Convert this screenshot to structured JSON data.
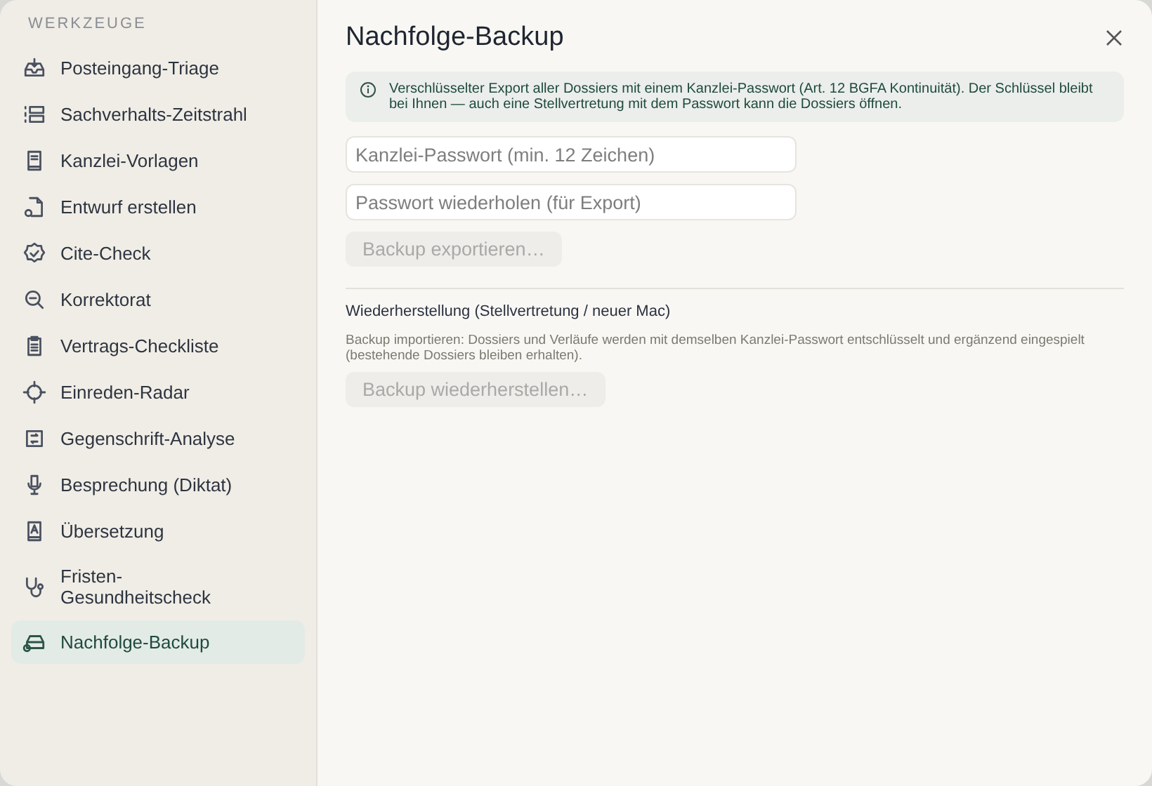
{
  "sidebar": {
    "heading": "WERKZEUGE",
    "items": [
      {
        "label": "Posteingang-Triage",
        "selected": false
      },
      {
        "label": "Sachverhalts-Zeitstrahl",
        "selected": false
      },
      {
        "label": "Kanzlei-Vorlagen",
        "selected": false
      },
      {
        "label": "Entwurf erstellen",
        "selected": false
      },
      {
        "label": "Cite-Check",
        "selected": false
      },
      {
        "label": "Korrektorat",
        "selected": false
      },
      {
        "label": "Vertrags-Checkliste",
        "selected": false
      },
      {
        "label": "Einreden-Radar",
        "selected": false
      },
      {
        "label": "Gegenschrift-Analyse",
        "selected": false
      },
      {
        "label": "Besprechung (Diktat)",
        "selected": false
      },
      {
        "label": "Übersetzung",
        "selected": false
      },
      {
        "label": "Fristen-\nGesundheitscheck",
        "selected": false
      },
      {
        "label": "Nachfolge-Backup",
        "selected": true
      }
    ]
  },
  "panel": {
    "title": "Nachfolge-Backup",
    "notice": "Verschlüsselter Export aller Dossiers mit einem Kanzlei-Passwort (Art. 12 BGFA Kontinuität). Der Schlüssel bleibt bei Ihnen — auch eine Stellvertretung mit dem Passwort kann die Dossiers öffnen.",
    "fields": [
      {
        "placeholder": "Kanzlei-Passwort (min. 12 Zeichen)"
      },
      {
        "placeholder": "Passwort wiederholen (für Export)"
      }
    ],
    "export_button": {
      "label": "Backup exportieren…",
      "disabled": true
    },
    "restore": {
      "heading": "Wiederherstellung (Stellvertretung / neuer Mac)",
      "description": "Backup importieren: Dossiers und Verläufe werden mit demselben Kanzlei-Passwort entschlüsselt und ergänzend eingespielt (bestehende Dossiers bleiben erhalten).",
      "button": {
        "label": "Backup wiederherstellen…",
        "disabled": true
      }
    }
  }
}
